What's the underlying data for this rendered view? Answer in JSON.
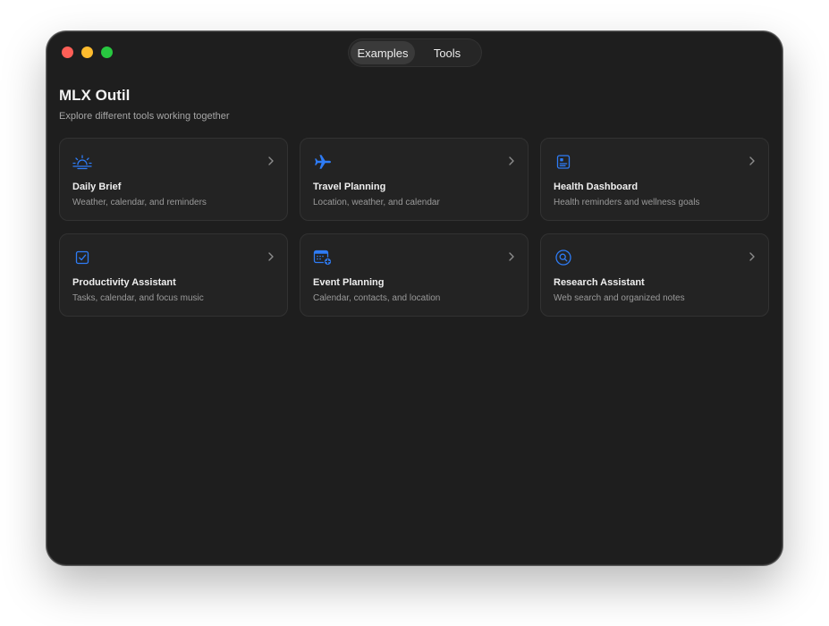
{
  "window": {
    "traffic_lights": [
      "close",
      "minimize",
      "zoom"
    ]
  },
  "toolbar": {
    "tabs": [
      {
        "label": "Examples",
        "selected": true
      },
      {
        "label": "Tools",
        "selected": false
      }
    ]
  },
  "main": {
    "title": "MLX Outil",
    "subtitle": "Explore different tools working together",
    "cards": [
      {
        "title": "Daily Brief",
        "description": "Weather, calendar, and reminders",
        "icon": "sunrise-icon"
      },
      {
        "title": "Travel Planning",
        "description": "Location, weather, and calendar",
        "icon": "airplane-icon"
      },
      {
        "title": "Health Dashboard",
        "description": "Health reminders and wellness goals",
        "icon": "list-clipboard-icon"
      },
      {
        "title": "Productivity Assistant",
        "description": "Tasks, calendar, and focus music",
        "icon": "checkbox-icon"
      },
      {
        "title": "Event Planning",
        "description": "Calendar, contacts, and location",
        "icon": "calendar-add-icon"
      },
      {
        "title": "Research Assistant",
        "description": "Web search and organized notes",
        "icon": "search-circle-icon"
      }
    ]
  },
  "colors": {
    "accent": "#2e7cf6",
    "window_bg": "#1e1e1e",
    "card_bg": "#232323",
    "text_primary": "#efefef",
    "text_secondary": "#9a9a9a"
  }
}
